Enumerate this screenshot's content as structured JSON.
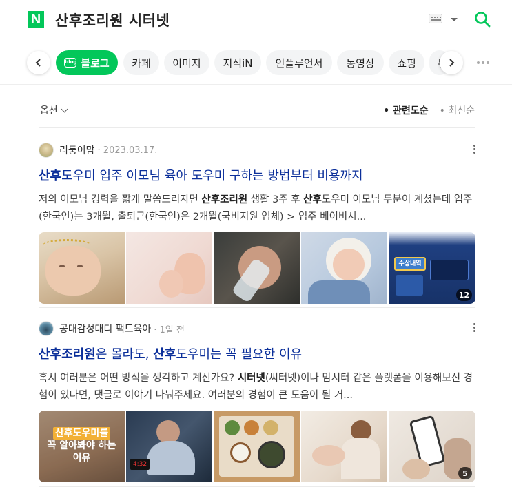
{
  "header": {
    "logo_letter": "N",
    "query": "산후조리원 시터넷"
  },
  "tabs": {
    "items": [
      {
        "label": "블로그",
        "active": true
      },
      {
        "label": "카페"
      },
      {
        "label": "이미지"
      },
      {
        "label": "지식iN"
      },
      {
        "label": "인플루언서"
      },
      {
        "label": "동영상"
      },
      {
        "label": "쇼핑"
      },
      {
        "label": "뉴"
      }
    ]
  },
  "options": {
    "label": "옵션",
    "sort_relevance": "관련도순",
    "sort_latest": "최신순"
  },
  "results": [
    {
      "author": "리둥이맘",
      "date": "· 2023.03.17.",
      "title_parts": [
        "산후",
        "도우미 입주 이모님 육아 도우미 구하는 방법부터 비용까지"
      ],
      "desc_parts": [
        "저의 이모님 경력을 짧게 말씀드리자면 ",
        "산후조리원",
        " 생활 3주 후 ",
        "산후",
        "도우미 이모님 두분이 계셨는데 입주(한국인)는 3개월, 출퇴근(한국인)은 2개월(국비지원 업체) > 입주 베이비시..."
      ],
      "image_count": "12",
      "thumb_image_text": "수상내역"
    },
    {
      "author": "공대감성대디 팩트육아",
      "date": "· 1일 전",
      "title_parts": [
        "산후조리원",
        "은 몰라도, ",
        "산후",
        "도우미는 꼭 필요한 이유"
      ],
      "desc_parts": [
        "혹시 여러분은 어떤 방식을 생각하고 계신가요? ",
        "시터넷",
        "(씨터넷)이나 맘시터 같은 플랫폼을 이용해보신 경험이 있다면, 댓글로 이야기 나눠주세요. 여러분의 경험이 큰 도움이 될 거..."
      ],
      "image_count": "5",
      "thumb_text": [
        "산후도우미를",
        "꼭 알아봐야 하는",
        "이유"
      ]
    }
  ],
  "colors": {
    "brand_green": "#03c75a",
    "title_blue": "#0b2f9a"
  }
}
